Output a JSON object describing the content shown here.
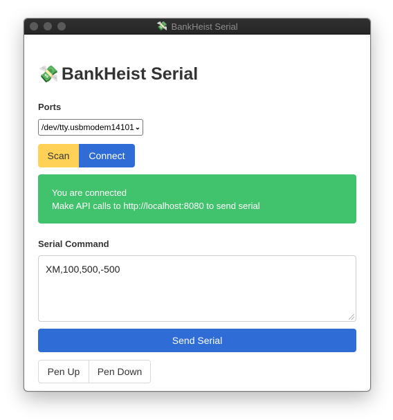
{
  "window": {
    "title": "BankHeist Serial",
    "title_icon": "money-with-wings-icon"
  },
  "app": {
    "title": "BankHeist Serial",
    "title_icon": "money-with-wings-icon"
  },
  "ports": {
    "label": "Ports",
    "selected": "/dev/tty.usbmodem14101"
  },
  "actions": {
    "scan_label": "Scan",
    "connect_label": "Connect"
  },
  "status": {
    "line1": "You are connected",
    "line2": "Make API calls to http://localhost:8080 to send serial",
    "color": "#41c26c"
  },
  "serial": {
    "label": "Serial Command",
    "value": "XM,100,500,-500",
    "send_label": "Send Serial"
  },
  "pen": {
    "up_label": "Pen Up",
    "down_label": "Pen Down"
  },
  "colors": {
    "primary": "#2f6cd6",
    "warning": "#ffd257",
    "success": "#41c26c"
  }
}
